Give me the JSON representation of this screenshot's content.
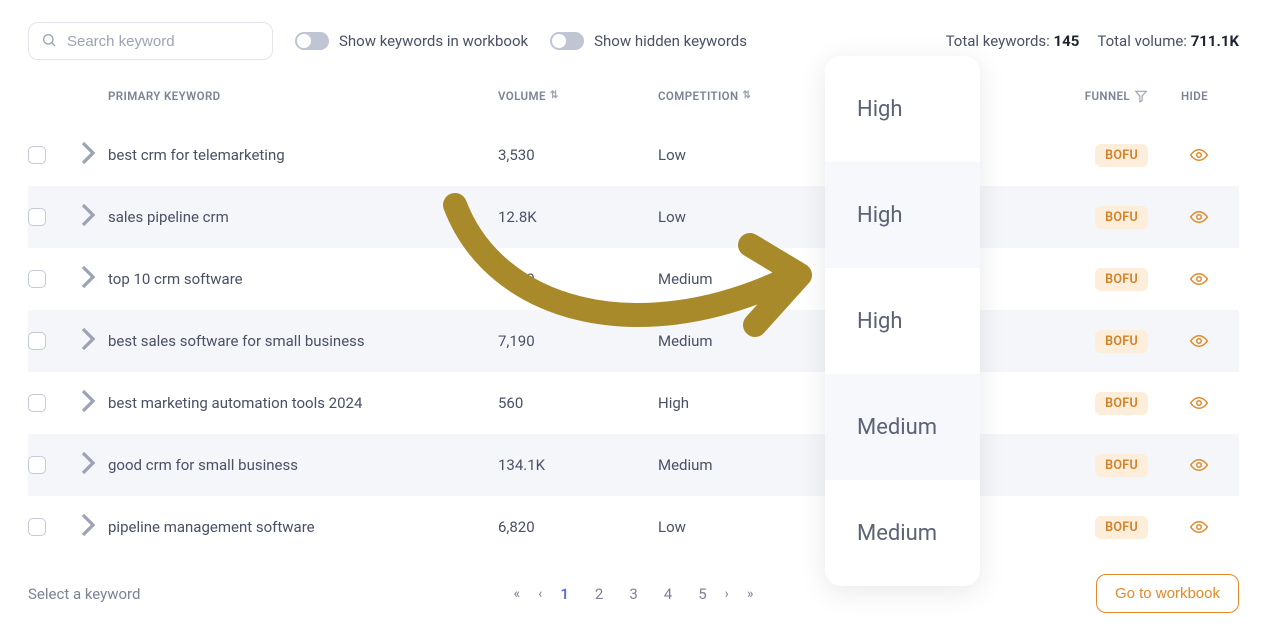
{
  "search": {
    "placeholder": "Search keyword"
  },
  "toggles": {
    "workbook_label": "Show keywords in workbook",
    "hidden_label": "Show hidden keywords"
  },
  "stats": {
    "total_keywords_label": "Total keywords:",
    "total_keywords_value": "145",
    "total_volume_label": "Total volume:",
    "total_volume_value": "711.1K"
  },
  "columns": {
    "primary_keyword": "PRIMARY KEYWORD",
    "volume": "VOLUME",
    "competition": "COMPETITION",
    "funnel": "FUNNEL",
    "hide": "HIDE"
  },
  "rows": [
    {
      "keyword": "best crm for telemarketing",
      "volume": "3,530",
      "competition": "Low",
      "funnel": "BOFU"
    },
    {
      "keyword": "sales pipeline crm",
      "volume": "12.8K",
      "competition": "Low",
      "funnel": "BOFU"
    },
    {
      "keyword": "top 10 crm software",
      "volume": "4,840",
      "competition": "Medium",
      "funnel": "BOFU"
    },
    {
      "keyword": "best sales software for small business",
      "volume": "7,190",
      "competition": "Medium",
      "funnel": "BOFU"
    },
    {
      "keyword": "best marketing automation tools 2024",
      "volume": "560",
      "competition": "High",
      "funnel": "BOFU"
    },
    {
      "keyword": "good crm for small business",
      "volume": "134.1K",
      "competition": "Medium",
      "funnel": "BOFU"
    },
    {
      "keyword": "pipeline management software",
      "volume": "6,820",
      "competition": "Low",
      "funnel": "BOFU"
    }
  ],
  "popover_items": [
    "High",
    "High",
    "High",
    "Medium",
    "Medium"
  ],
  "footer": {
    "select_hint": "Select a keyword",
    "go_button": "Go to workbook"
  },
  "pager": {
    "first": "«",
    "prev": "‹",
    "pages": [
      "1",
      "2",
      "3",
      "4",
      "5"
    ],
    "current_index": 0,
    "next": "›",
    "last": "»"
  }
}
